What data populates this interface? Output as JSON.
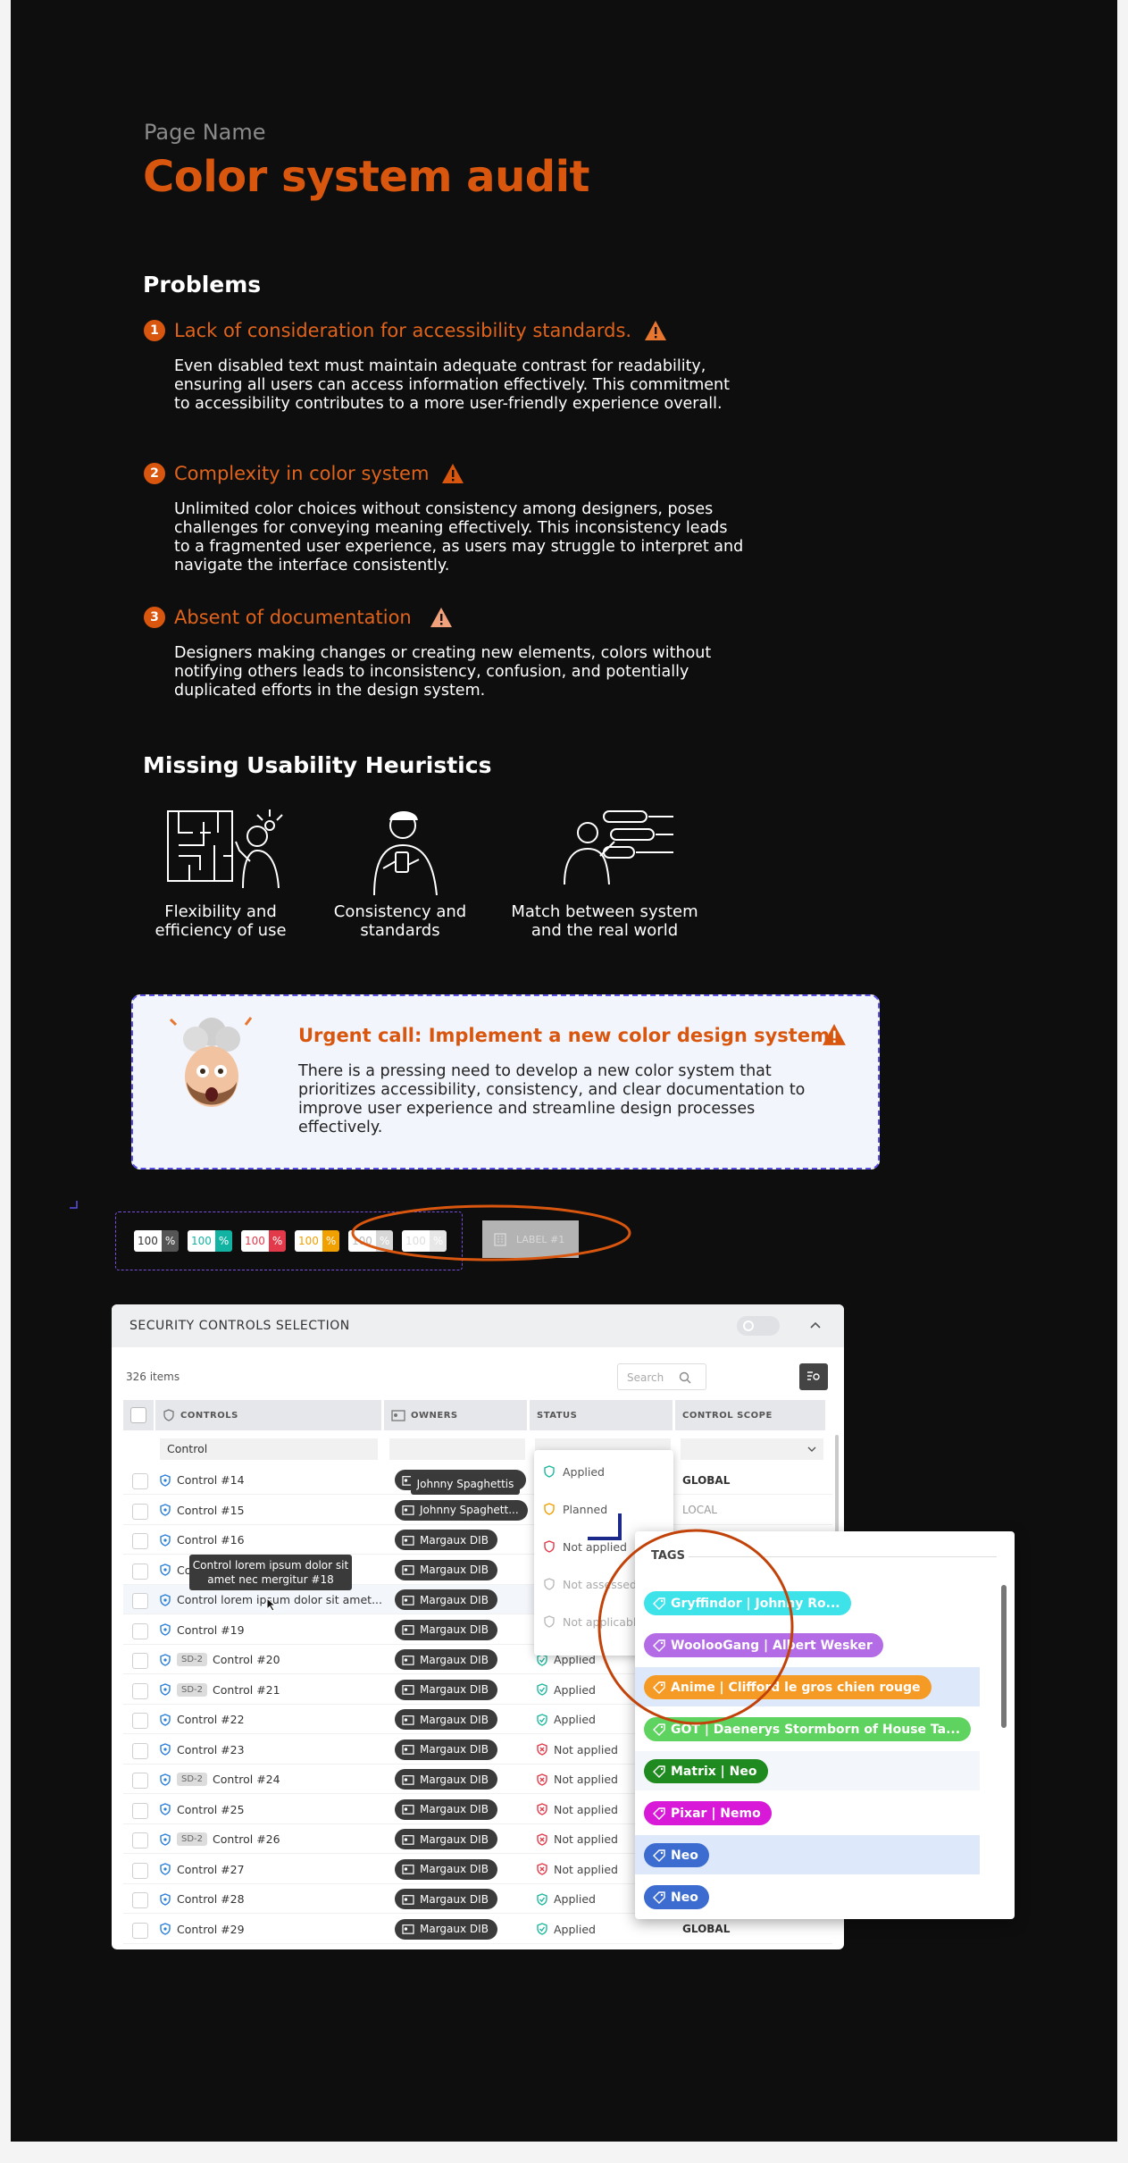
{
  "page": {
    "name": "Page Name",
    "title": "Color system audit"
  },
  "problems": {
    "heading": "Problems",
    "items": [
      {
        "number": "1",
        "title": "Lack of consideration for accessibility standards.",
        "body": "Even disabled text must maintain adequate contrast for readability, ensuring all users can access information effectively. This commitment to accessibility contributes to a more user-friendly experience overall."
      },
      {
        "number": "2",
        "title": "Complexity in color system",
        "body": "Unlimited color choices without consistency among designers, poses challenges for conveying meaning effectively. This inconsistency leads to a fragmented user experience, as users may struggle to interpret and navigate the interface consistently."
      },
      {
        "number": "3",
        "title": "Absent of documentation",
        "body": "Designers making changes or creating new elements, colors without notifying others leads to inconsistency, confusion, and potentially duplicated efforts in the design system."
      }
    ]
  },
  "heuristics": {
    "heading": "Missing Usability Heuristics",
    "items": [
      {
        "line1": "Flexibility and",
        "line2": "efficiency of use"
      },
      {
        "line1": "Consistency and",
        "line2": "standards"
      },
      {
        "line1": "Match between system",
        "line2": "and the real world"
      }
    ]
  },
  "urgent": {
    "title": "Urgent call: Implement a new color design system",
    "body": "There is a pressing need to develop a new color system that prioritizes accessibility, consistency, and clear documentation to improve user experience and streamline design processes effectively."
  },
  "chips": [
    {
      "value": "100",
      "unit": "%",
      "bg": "#ffffff",
      "fg": "#333333",
      "unitBg": "#555555",
      "unitFg": "#ffffff"
    },
    {
      "value": "100",
      "unit": "%",
      "bg": "#ffffff",
      "fg": "#13b3a3",
      "unitBg": "#13b3a3",
      "unitFg": "#ffffff"
    },
    {
      "value": "100",
      "unit": "%",
      "bg": "#ffffff",
      "fg": "#e23a4a",
      "unitBg": "#e23a4a",
      "unitFg": "#ffffff"
    },
    {
      "value": "100",
      "unit": "%",
      "bg": "#ffffff",
      "fg": "#f0a000",
      "unitBg": "#f0a000",
      "unitFg": "#ffffff"
    },
    {
      "value": "100",
      "unit": "%",
      "bg": "#ffffff",
      "fg": "#bbbbbb",
      "unitBg": "#d7d7d7",
      "unitFg": "#ffffff"
    },
    {
      "value": "100",
      "unit": "%",
      "bg": "#ffffff",
      "fg": "#dddddd",
      "unitBg": "#e7e7e7",
      "unitFg": "#ffffff"
    }
  ],
  "label_box": {
    "text": "LABEL #1"
  },
  "security": {
    "title": "SECURITY CONTROLS SELECTION",
    "count": "326 items",
    "search_placeholder": "Search",
    "columns": [
      "CONTROLS",
      "OWNERS",
      "STATUS",
      "CONTROL SCOPE"
    ],
    "filter": {
      "control": "Control"
    },
    "rows": [
      {
        "control": "Control #14",
        "sd": "",
        "owner": "Johnny Spaghettis",
        "status": "",
        "scope": "GLOBAL"
      },
      {
        "control": "Control #15",
        "sd": "",
        "owner": "Johnny Spaghett...",
        "status": "",
        "scope": "LOCAL"
      },
      {
        "control": "Control #16",
        "sd": "",
        "owner": "Margaux DIB",
        "status": "",
        "scope": ""
      },
      {
        "control": "Control #17",
        "sd": "",
        "owner": "Margaux DIB",
        "status": "",
        "scope": ""
      },
      {
        "control": "Control lorem ipsum dolor sit amet...",
        "sd": "",
        "owner": "Margaux DIB",
        "status": "",
        "scope": ""
      },
      {
        "control": "Control #19",
        "sd": "",
        "owner": "Margaux DIB",
        "status": "",
        "scope": ""
      },
      {
        "control": "Control #20",
        "sd": "SD-2",
        "owner": "Margaux DIB",
        "status": "Applied",
        "scope": ""
      },
      {
        "control": "Control #21",
        "sd": "SD-2",
        "owner": "Margaux DIB",
        "status": "Applied",
        "scope": ""
      },
      {
        "control": "Control #22",
        "sd": "",
        "owner": "Margaux DIB",
        "status": "Applied",
        "scope": ""
      },
      {
        "control": "Control #23",
        "sd": "",
        "owner": "Margaux DIB",
        "status": "Not applied",
        "scope": ""
      },
      {
        "control": "Control #24",
        "sd": "SD-2",
        "owner": "Margaux DIB",
        "status": "Not applied",
        "scope": ""
      },
      {
        "control": "Control #25",
        "sd": "",
        "owner": "Margaux DIB",
        "status": "Not applied",
        "scope": ""
      },
      {
        "control": "Control #26",
        "sd": "SD-2",
        "owner": "Margaux DIB",
        "status": "Not applied",
        "scope": ""
      },
      {
        "control": "Control #27",
        "sd": "",
        "owner": "Margaux DIB",
        "status": "Not applied",
        "scope": ""
      },
      {
        "control": "Control #28",
        "sd": "",
        "owner": "Margaux DIB",
        "status": "Applied",
        "scope": ""
      },
      {
        "control": "Control #29",
        "sd": "",
        "owner": "Margaux DIB",
        "status": "Applied",
        "scope": "GLOBAL"
      }
    ],
    "owner_tooltip": "Johnny Spaghettis",
    "control_tooltip_line1": "Control lorem ipsum dolor sit",
    "control_tooltip_line2": "amet nec mergitur #18",
    "status_options": [
      "Applied",
      "Planned",
      "Not applied",
      "Not assessed",
      "Not applicable"
    ]
  },
  "tags": {
    "heading": "TAGS",
    "items": [
      {
        "label": "Gryffindor | Johnny Ro...",
        "color": "#3ee3ea",
        "highlight": false
      },
      {
        "label": "WoolooGang | Albert Wesker",
        "color": "#b36be6",
        "highlight": false
      },
      {
        "label": "Anime | Clifford le gros chien rouge",
        "color": "#f59a24",
        "highlight": true
      },
      {
        "label": "GOT | Daenerys Stormborn of House Ta...",
        "color": "#5fd35f",
        "highlight": false
      },
      {
        "label": "Matrix | Neo",
        "color": "#1f8a1f",
        "highlight": false
      },
      {
        "label": "Pixar | Nemo",
        "color": "#d81ad8",
        "highlight": false
      },
      {
        "label": "Neo",
        "color": "#3c6cd0",
        "highlight": true
      },
      {
        "label": "Neo",
        "color": "#3c6cd0",
        "highlight": false
      }
    ]
  }
}
